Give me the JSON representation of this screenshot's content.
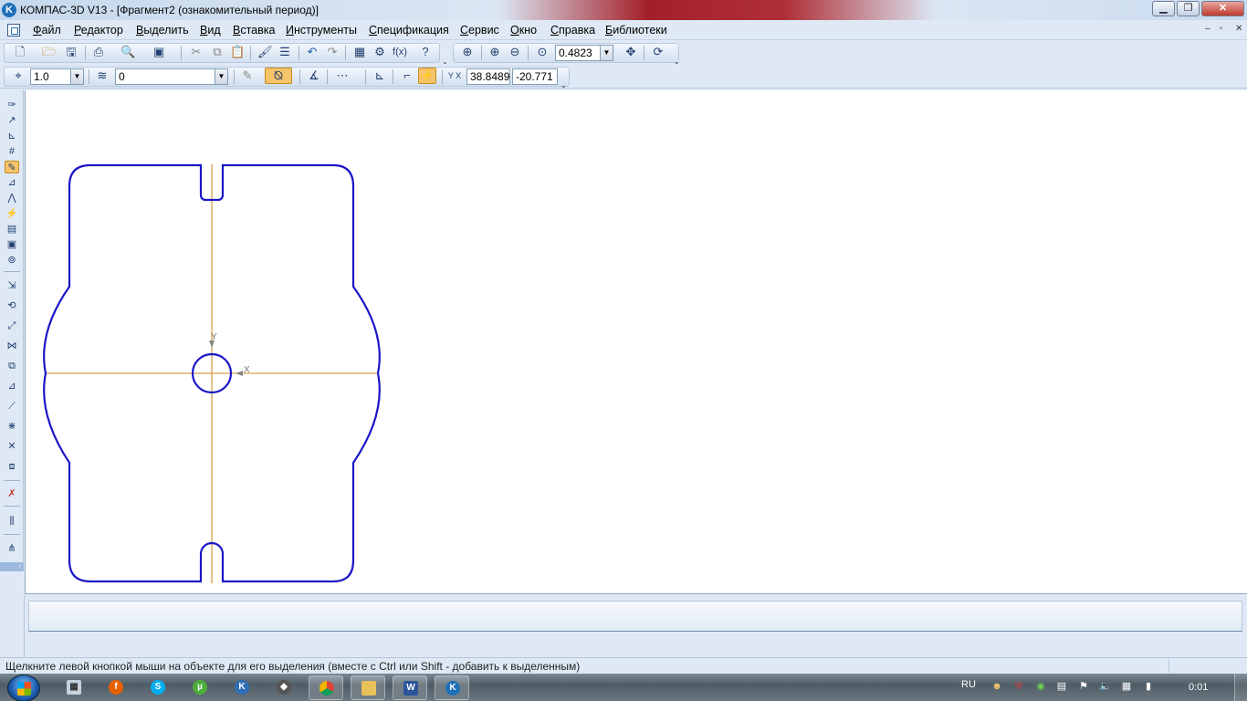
{
  "window": {
    "title": "КОМПАС-3D V13 - [Фрагмент2 (ознакомительный период)]",
    "logo_letter": "K",
    "controls": {
      "minimize": "▁",
      "maximize": "❐",
      "close": "✕"
    }
  },
  "menu": {
    "items": [
      "Файл",
      "Редактор",
      "Выделить",
      "Вид",
      "Вставка",
      "Инструменты",
      "Спецификация",
      "Сервис",
      "Окно",
      "Справка",
      "Библиотеки"
    ],
    "mdi_controls": {
      "minimize": "–",
      "restore": "▫",
      "close": "✕"
    }
  },
  "toolbar_standard": {
    "zoom_value": "0.4823",
    "zoom_dropdown_arrow": "▼"
  },
  "toolbar_current_state": {
    "step_value": "1.0",
    "layer_value": "0",
    "cursor_x": "38.8489",
    "cursor_y": "-20.771",
    "dropdown_arrow": "▼",
    "coords_label": "Y X"
  },
  "drawing": {
    "axis_x_label": "X",
    "axis_y_label": "Y",
    "contour_color": "#1a16c8",
    "axis_color": "#d4a24c"
  },
  "status": {
    "message": "Щелкните левой кнопкой мыши на объекте для его выделения (вместе с Ctrl или Shift - добавить к выделенным)"
  },
  "taskbar": {
    "language": "RU",
    "time": "0:01"
  },
  "icons": {
    "new": "new-document-icon",
    "open": "open-folder-icon",
    "save": "save-icon",
    "print": "print-icon",
    "preview": "print-preview-icon",
    "cut": "cut-icon",
    "copy": "copy-icon",
    "paste": "paste-icon",
    "undo": "undo-icon",
    "redo": "redo-icon",
    "help": "help-pointer-icon",
    "pan": "pan-icon",
    "refresh": "refresh-icon"
  }
}
